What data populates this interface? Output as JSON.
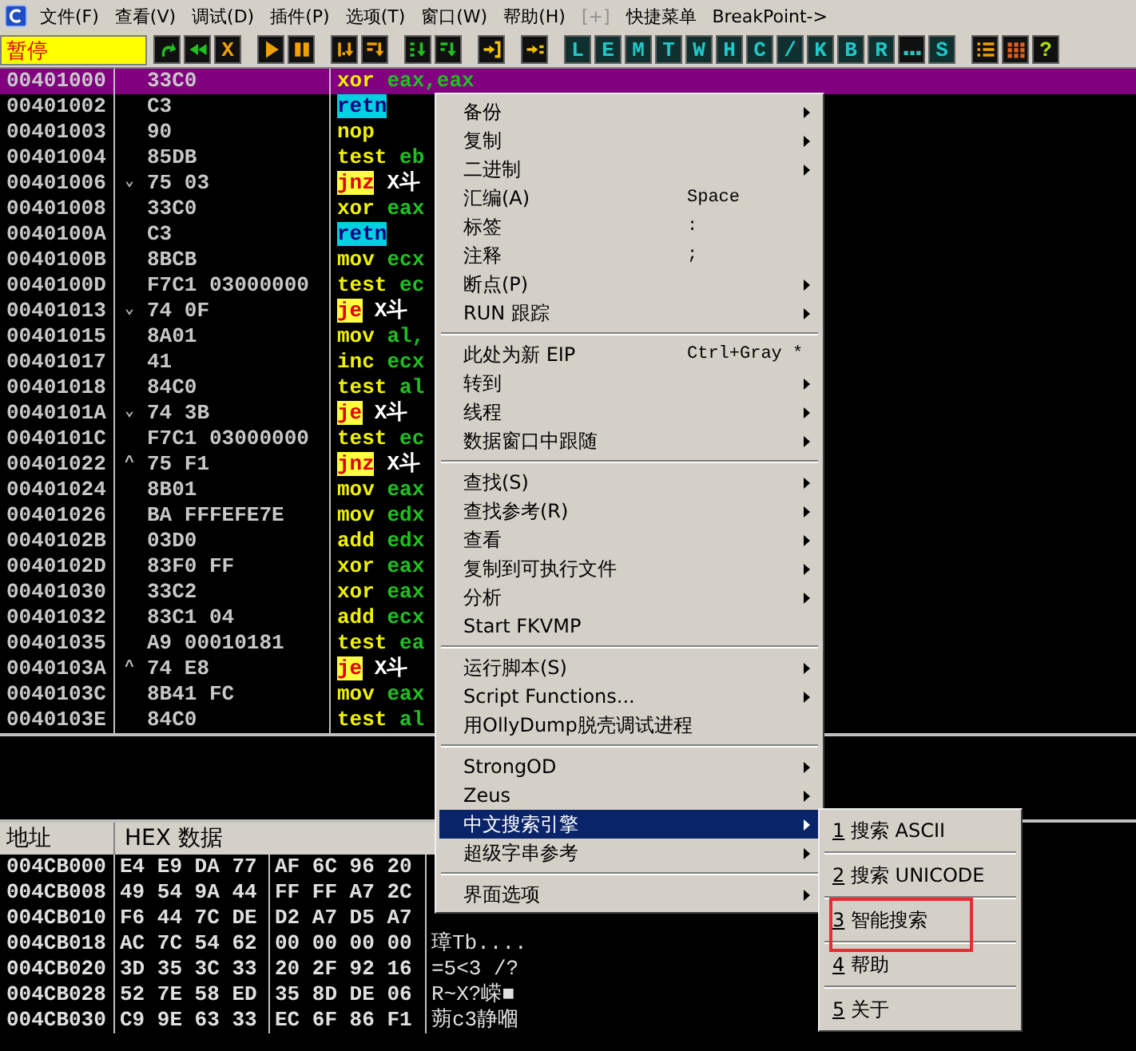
{
  "menu_bar": {
    "items": [
      {
        "label": "文件(F)",
        "disabled": false
      },
      {
        "label": "查看(V)",
        "disabled": false
      },
      {
        "label": "调试(D)",
        "disabled": false
      },
      {
        "label": "插件(P)",
        "disabled": false
      },
      {
        "label": "选项(T)",
        "disabled": false
      },
      {
        "label": "窗口(W)",
        "disabled": false
      },
      {
        "label": "帮助(H)",
        "disabled": false
      },
      {
        "label": "[+]",
        "disabled": true
      },
      {
        "label": "快捷菜单",
        "disabled": false
      },
      {
        "label": "BreakPoint->",
        "disabled": false
      }
    ]
  },
  "toolbar": {
    "status": "暂停",
    "groups": [
      [
        {
          "kind": "redo"
        },
        {
          "kind": "rewind"
        },
        {
          "kind": "close",
          "label": "X"
        }
      ],
      [
        {
          "kind": "play"
        },
        {
          "kind": "pause"
        }
      ],
      [
        {
          "kind": "stepin"
        },
        {
          "kind": "stepover"
        }
      ],
      [
        {
          "kind": "tracein"
        },
        {
          "kind": "traceover"
        }
      ],
      [
        {
          "kind": "return"
        }
      ],
      [
        {
          "kind": "user"
        }
      ],
      [
        {
          "kind": "letter",
          "label": "L"
        },
        {
          "kind": "letter",
          "label": "E"
        },
        {
          "kind": "letter",
          "label": "M"
        },
        {
          "kind": "letter",
          "label": "T"
        },
        {
          "kind": "letter",
          "label": "W"
        },
        {
          "kind": "letter",
          "label": "H"
        },
        {
          "kind": "letter",
          "label": "C"
        },
        {
          "kind": "letter",
          "label": "/"
        },
        {
          "kind": "letter",
          "label": "K"
        },
        {
          "kind": "letter",
          "label": "B"
        },
        {
          "kind": "letter",
          "label": "R"
        },
        {
          "kind": "dots"
        },
        {
          "kind": "letter",
          "label": "S"
        }
      ],
      [
        {
          "kind": "list"
        },
        {
          "kind": "grid"
        },
        {
          "kind": "help",
          "label": "?"
        }
      ]
    ]
  },
  "disassembly": {
    "rows": [
      {
        "address": "00401000",
        "hex": "33C0",
        "mnemonic": "xor",
        "operand": "eax,eax",
        "kind": "plain",
        "selected": true
      },
      {
        "address": "00401002",
        "hex": "C3",
        "mnemonic": "retn",
        "kind": "return",
        "selected": false
      },
      {
        "address": "00401003",
        "hex": "90",
        "mnemonic": "nop",
        "kind": "plain",
        "selected": false
      },
      {
        "address": "00401004",
        "hex": "85DB",
        "mnemonic": "test",
        "operand": "eb",
        "kind": "plain",
        "selected": false
      },
      {
        "address": "00401006",
        "jump": "⌄",
        "hex": "75 03",
        "mnemonic": "jnz",
        "operand": "X斗",
        "kind": "jump",
        "selected": false
      },
      {
        "address": "00401008",
        "hex": "33C0",
        "mnemonic": "xor",
        "operand": "eax",
        "kind": "plain",
        "selected": false
      },
      {
        "address": "0040100A",
        "hex": "C3",
        "mnemonic": "retn",
        "kind": "return",
        "selected": false
      },
      {
        "address": "0040100B",
        "hex": "8BCB",
        "mnemonic": "mov",
        "operand": "ecx",
        "kind": "plain",
        "selected": false
      },
      {
        "address": "0040100D",
        "hex": "F7C1 03000000",
        "mnemonic": "test",
        "operand": "ec",
        "kind": "plain",
        "selected": false
      },
      {
        "address": "00401013",
        "jump": "⌄",
        "hex": "74 0F",
        "mnemonic": "je",
        "operand": "X斗",
        "kind": "jump",
        "selected": false
      },
      {
        "address": "00401015",
        "hex": "8A01",
        "mnemonic": "mov",
        "operand": "al,",
        "kind": "plain",
        "selected": false
      },
      {
        "address": "00401017",
        "hex": "41",
        "mnemonic": "inc",
        "operand": "ecx",
        "kind": "plain",
        "selected": false
      },
      {
        "address": "00401018",
        "hex": "84C0",
        "mnemonic": "test",
        "operand": "al",
        "kind": "plain",
        "selected": false
      },
      {
        "address": "0040101A",
        "jump": "⌄",
        "hex": "74 3B",
        "mnemonic": "je",
        "operand": "X斗",
        "kind": "jump",
        "selected": false
      },
      {
        "address": "0040101C",
        "hex": "F7C1 03000000",
        "mnemonic": "test",
        "operand": "ec",
        "kind": "plain",
        "selected": false
      },
      {
        "address": "00401022",
        "jump": "^",
        "hex": "75 F1",
        "mnemonic": "jnz",
        "operand": "X斗",
        "kind": "jump",
        "selected": false
      },
      {
        "address": "00401024",
        "hex": "8B01",
        "mnemonic": "mov",
        "operand": "eax",
        "kind": "plain",
        "selected": false
      },
      {
        "address": "00401026",
        "hex": "BA FFFEFE7E",
        "mnemonic": "mov",
        "operand": "edx",
        "kind": "plain",
        "selected": false
      },
      {
        "address": "0040102B",
        "hex": "03D0",
        "mnemonic": "add",
        "operand": "edx",
        "kind": "plain",
        "selected": false
      },
      {
        "address": "0040102D",
        "hex": "83F0 FF",
        "mnemonic": "xor",
        "operand": "eax",
        "kind": "plain",
        "selected": false
      },
      {
        "address": "00401030",
        "hex": "33C2",
        "mnemonic": "xor",
        "operand": "eax",
        "kind": "plain",
        "selected": false
      },
      {
        "address": "00401032",
        "hex": "83C1 04",
        "mnemonic": "add",
        "operand": "ecx",
        "kind": "plain",
        "selected": false
      },
      {
        "address": "00401035",
        "hex": "A9 00010181",
        "mnemonic": "test",
        "operand": "ea",
        "kind": "plain",
        "selected": false
      },
      {
        "address": "0040103A",
        "jump": "^",
        "hex": "74 E8",
        "mnemonic": "je",
        "operand": "X斗",
        "kind": "jump",
        "selected": false
      },
      {
        "address": "0040103C",
        "hex": "8B41 FC",
        "mnemonic": "mov",
        "operand": "eax",
        "kind": "plain",
        "selected": false
      },
      {
        "address": "0040103E",
        "hex": "84C0",
        "mnemonic": "test",
        "operand": "al",
        "kind": "plain",
        "selected": false
      }
    ]
  },
  "dump": {
    "columns": [
      "地址",
      "HEX 数据"
    ],
    "rows": [
      {
        "address": "004CB000",
        "hex": [
          "E4 E9 DA 77",
          "AF 6C 96 20"
        ]
      },
      {
        "address": "004CB008",
        "hex": [
          "49 54 9A 44",
          "FF FF A7 2C"
        ]
      },
      {
        "address": "004CB010",
        "hex": [
          "F6 44 7C DE",
          "D2 A7 D5 A7"
        ]
      },
      {
        "address": "004CB018",
        "hex": [
          "AC 7C 54 62",
          "00 00 00 00"
        ],
        "ascii": "璋Tb...."
      },
      {
        "address": "004CB020",
        "hex": [
          "3D 35 3C 33",
          "20 2F 92 16"
        ],
        "ascii": "=5<3 /?"
      },
      {
        "address": "004CB028",
        "hex": [
          "52 7E 58 ED",
          "35 8D DE 06"
        ],
        "ascii": "R~X?嵘■"
      },
      {
        "address": "004CB030",
        "hex": [
          "C9 9E 63 33",
          "EC 6F 86 F1"
        ],
        "ascii": "蒴c3静嗰"
      }
    ]
  },
  "context_menu": {
    "groups": [
      [
        {
          "label": "备份",
          "submenu": true,
          "selected": false
        },
        {
          "label": "复制",
          "submenu": true,
          "selected": false
        },
        {
          "label": "二进制",
          "submenu": true,
          "selected": false
        },
        {
          "label": "汇编(A)",
          "shortcut": "Space",
          "submenu": false,
          "selected": false
        },
        {
          "label": "标签",
          "shortcut": ":",
          "submenu": false,
          "selected": false
        },
        {
          "label": "注释",
          "shortcut": ";",
          "submenu": false,
          "selected": false
        },
        {
          "label": "断点(P)",
          "submenu": true,
          "selected": false
        },
        {
          "label": "RUN 跟踪",
          "submenu": true,
          "selected": false
        }
      ],
      [
        {
          "label": "此处为新 EIP",
          "shortcut": "Ctrl+Gray *",
          "submenu": false,
          "selected": false
        },
        {
          "label": "转到",
          "submenu": true,
          "selected": false
        },
        {
          "label": "线程",
          "submenu": true,
          "selected": false
        },
        {
          "label": "数据窗口中跟随",
          "submenu": true,
          "selected": false
        }
      ],
      [
        {
          "label": "查找(S)",
          "submenu": true,
          "selected": false
        },
        {
          "label": "查找参考(R)",
          "submenu": true,
          "selected": false
        },
        {
          "label": "查看",
          "submenu": true,
          "selected": false
        },
        {
          "label": "复制到可执行文件",
          "submenu": true,
          "selected": false
        },
        {
          "label": "分析",
          "submenu": true,
          "selected": false
        },
        {
          "label": "Start FKVMP",
          "submenu": false,
          "selected": false
        }
      ],
      [
        {
          "label": "运行脚本(S)",
          "submenu": true,
          "selected": false
        },
        {
          "label": "Script Functions...",
          "submenu": true,
          "selected": false
        },
        {
          "label": "用OllyDump脱壳调试进程",
          "submenu": false,
          "selected": false
        }
      ],
      [
        {
          "label": "StrongOD",
          "submenu": true,
          "selected": false
        },
        {
          "label": "Zeus",
          "submenu": true,
          "selected": false
        },
        {
          "label": "中文搜索引擎",
          "submenu": true,
          "selected": true
        },
        {
          "label": "超级字串参考",
          "submenu": true,
          "selected": false
        }
      ],
      [
        {
          "label": "界面选项",
          "submenu": true,
          "selected": false
        }
      ]
    ]
  },
  "submenu": {
    "items": [
      {
        "number": "1",
        "label": "搜索 ASCII",
        "marked": false
      },
      {
        "number": "2",
        "label": "搜索 UNICODE",
        "marked": false
      },
      {
        "number": "3",
        "label": "智能搜索",
        "marked": true
      },
      {
        "number": "4",
        "label": "帮助",
        "marked": false
      },
      {
        "number": "5",
        "label": "关于",
        "marked": false
      }
    ]
  }
}
